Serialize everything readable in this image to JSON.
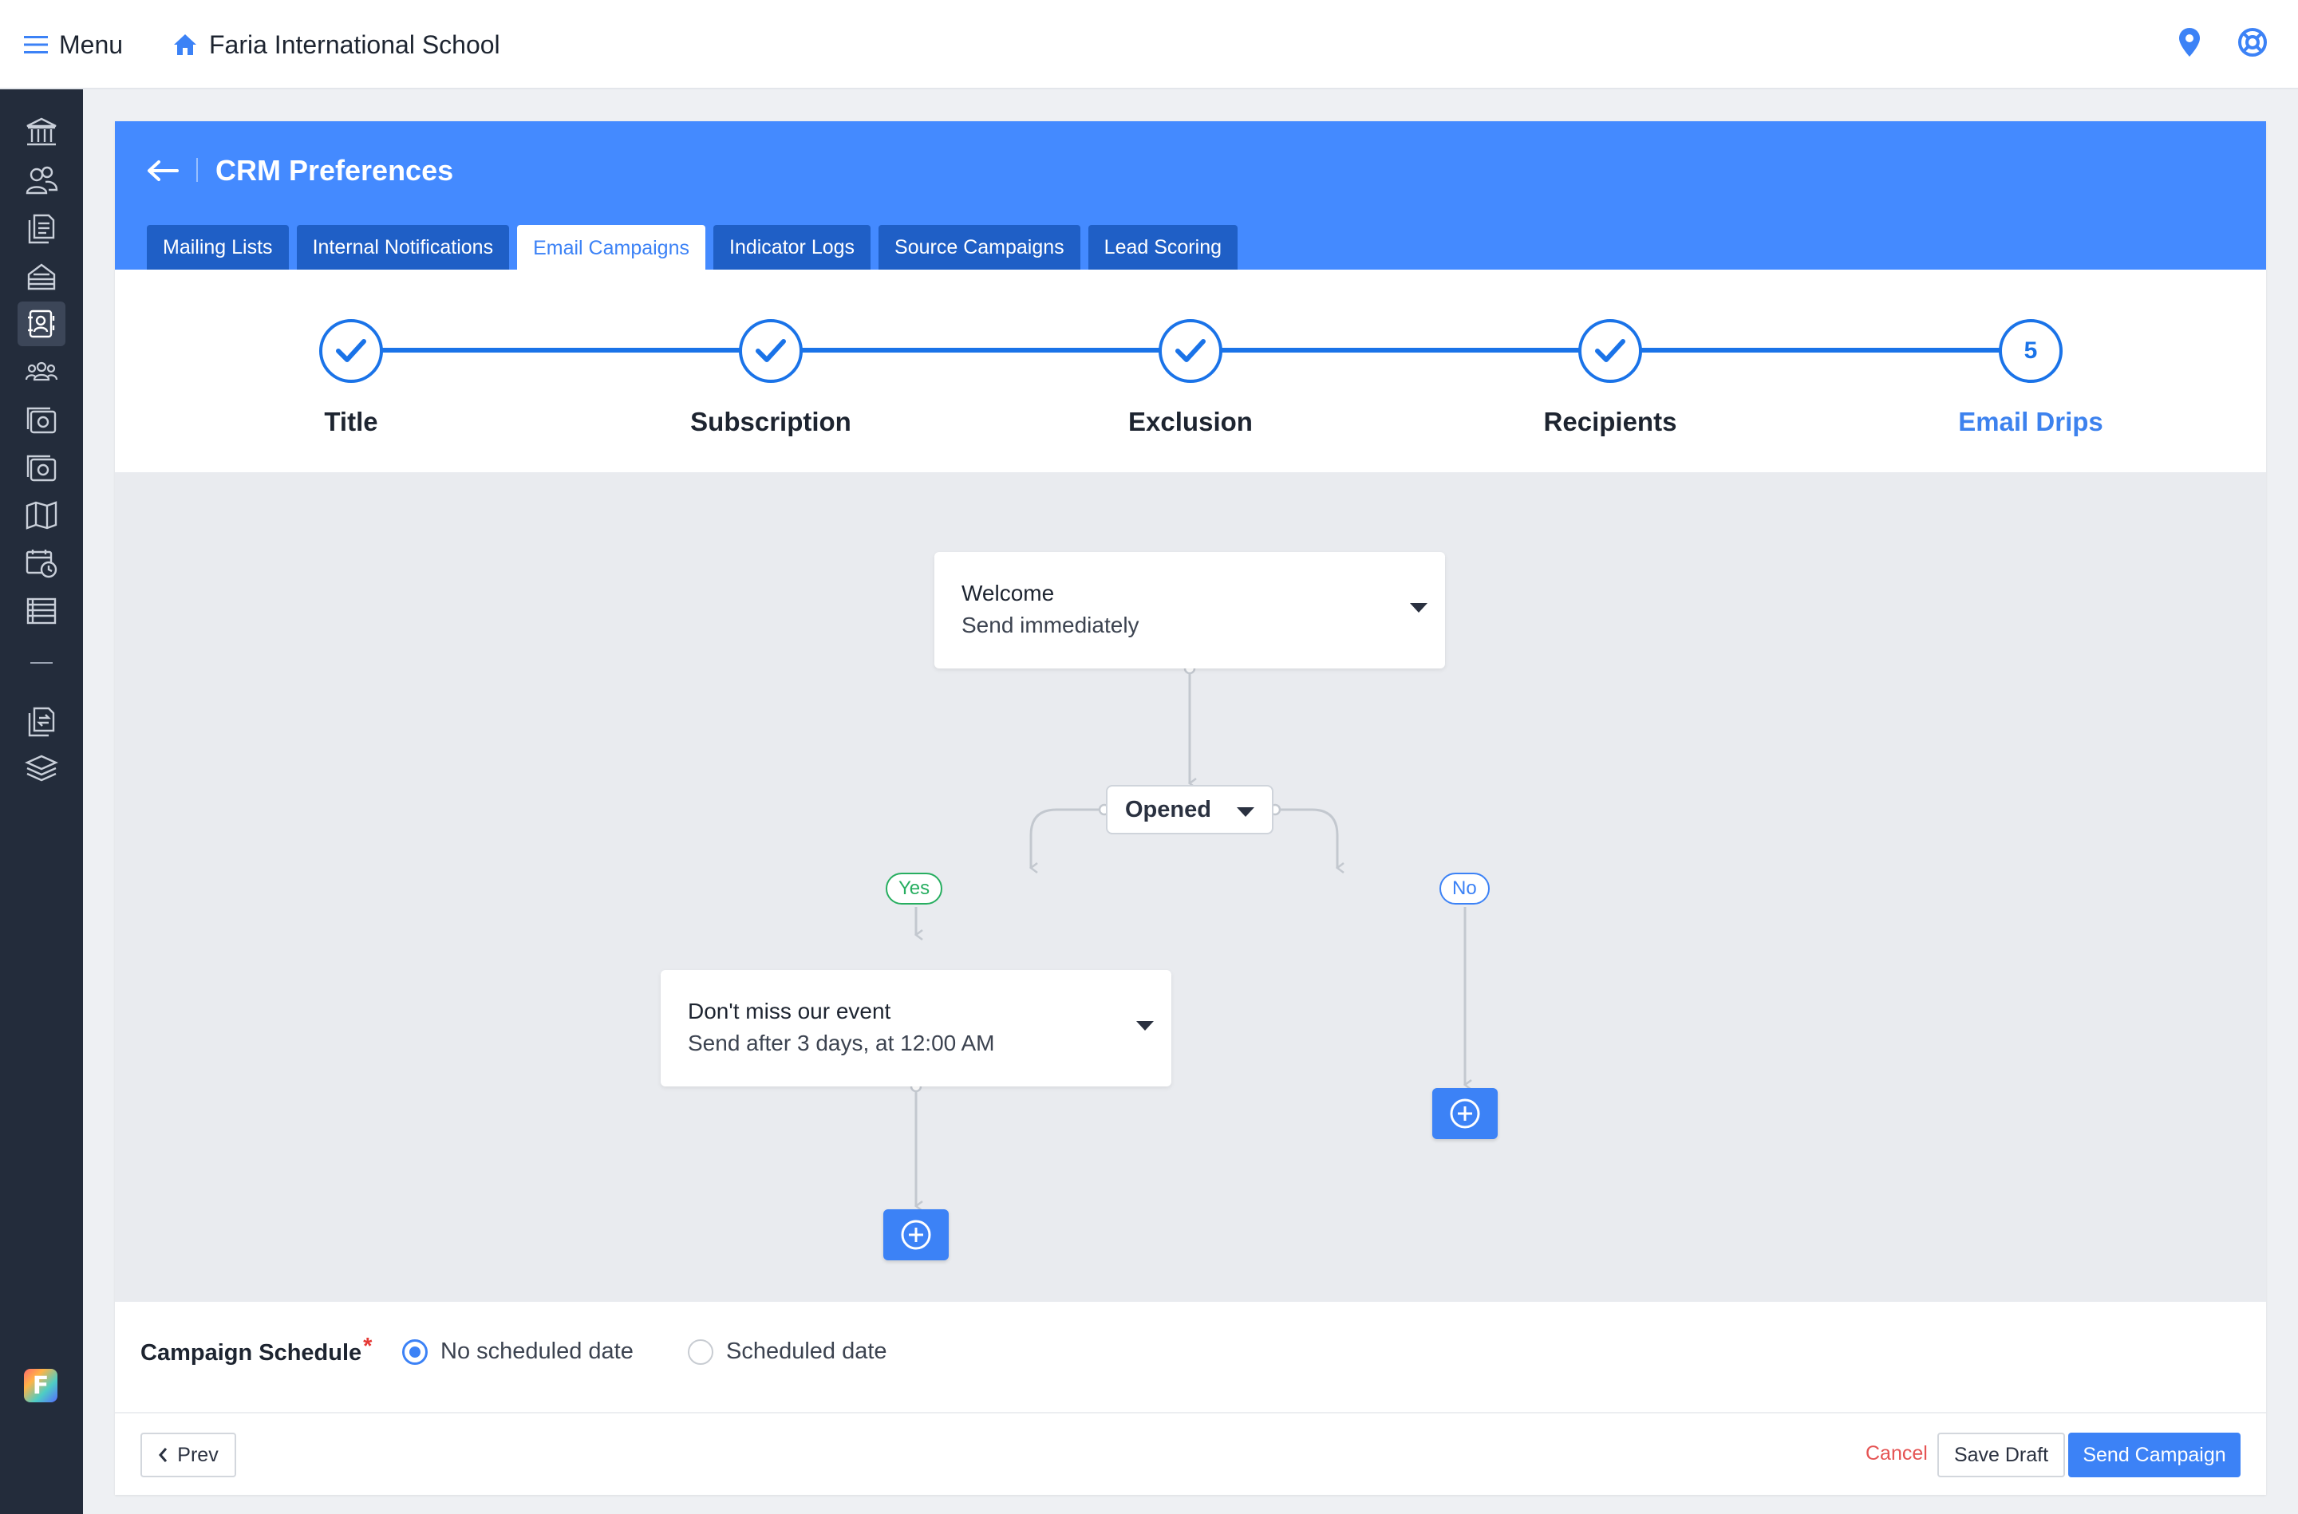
{
  "topbar": {
    "menu_label": "Menu",
    "school_name": "Faria International School",
    "icons": [
      "menu-icon",
      "home-icon",
      "location-pin-icon",
      "help-lifebuoy-icon"
    ]
  },
  "sidebar": {
    "icons": [
      "institution-icon",
      "users-icon",
      "documents-icon",
      "admissions-icon",
      "crm-contacts-icon",
      "groups-icon",
      "camera-icon",
      "camera-alt-icon",
      "map-icon",
      "calendar-clock-icon",
      "list-icon",
      "file-transfer-icon",
      "layers-icon"
    ],
    "active_index": 4
  },
  "header": {
    "title": "CRM Preferences",
    "tabs": [
      {
        "label": "Mailing Lists",
        "active": false
      },
      {
        "label": "Internal Notifications",
        "active": false
      },
      {
        "label": "Email Campaigns",
        "active": true
      },
      {
        "label": "Indicator Logs",
        "active": false
      },
      {
        "label": "Source Campaigns",
        "active": false
      },
      {
        "label": "Lead Scoring",
        "active": false
      }
    ]
  },
  "stepper": {
    "steps": [
      {
        "label": "Title",
        "state": "done"
      },
      {
        "label": "Subscription",
        "state": "done"
      },
      {
        "label": "Exclusion",
        "state": "done"
      },
      {
        "label": "Recipients",
        "state": "done"
      },
      {
        "label": "Email Drips",
        "state": "current",
        "number": "5"
      }
    ],
    "color": "#1a73e8"
  },
  "flow": {
    "node1": {
      "title": "Welcome",
      "subtitle": "Send immediately"
    },
    "condition": {
      "label": "Opened"
    },
    "yes_label": "Yes",
    "no_label": "No",
    "node2": {
      "title": "Don't miss our event",
      "subtitle": "Send after 3 days, at 12:00 AM"
    }
  },
  "schedule": {
    "label": "Campaign Schedule",
    "required_mark": "*",
    "options": [
      {
        "label": "No scheduled date",
        "selected": true
      },
      {
        "label": "Scheduled date",
        "selected": false
      }
    ]
  },
  "footer": {
    "prev_label": "Prev",
    "cancel_label": "Cancel",
    "save_label": "Save Draft",
    "send_label": "Send Campaign"
  },
  "colors": {
    "header_blue": "#448aff",
    "tab_dark": "#1f5fc6",
    "accent": "#3c82f6",
    "yes_green": "#27ae60",
    "cancel_red": "#e55353",
    "sidebar": "#232c3b"
  }
}
